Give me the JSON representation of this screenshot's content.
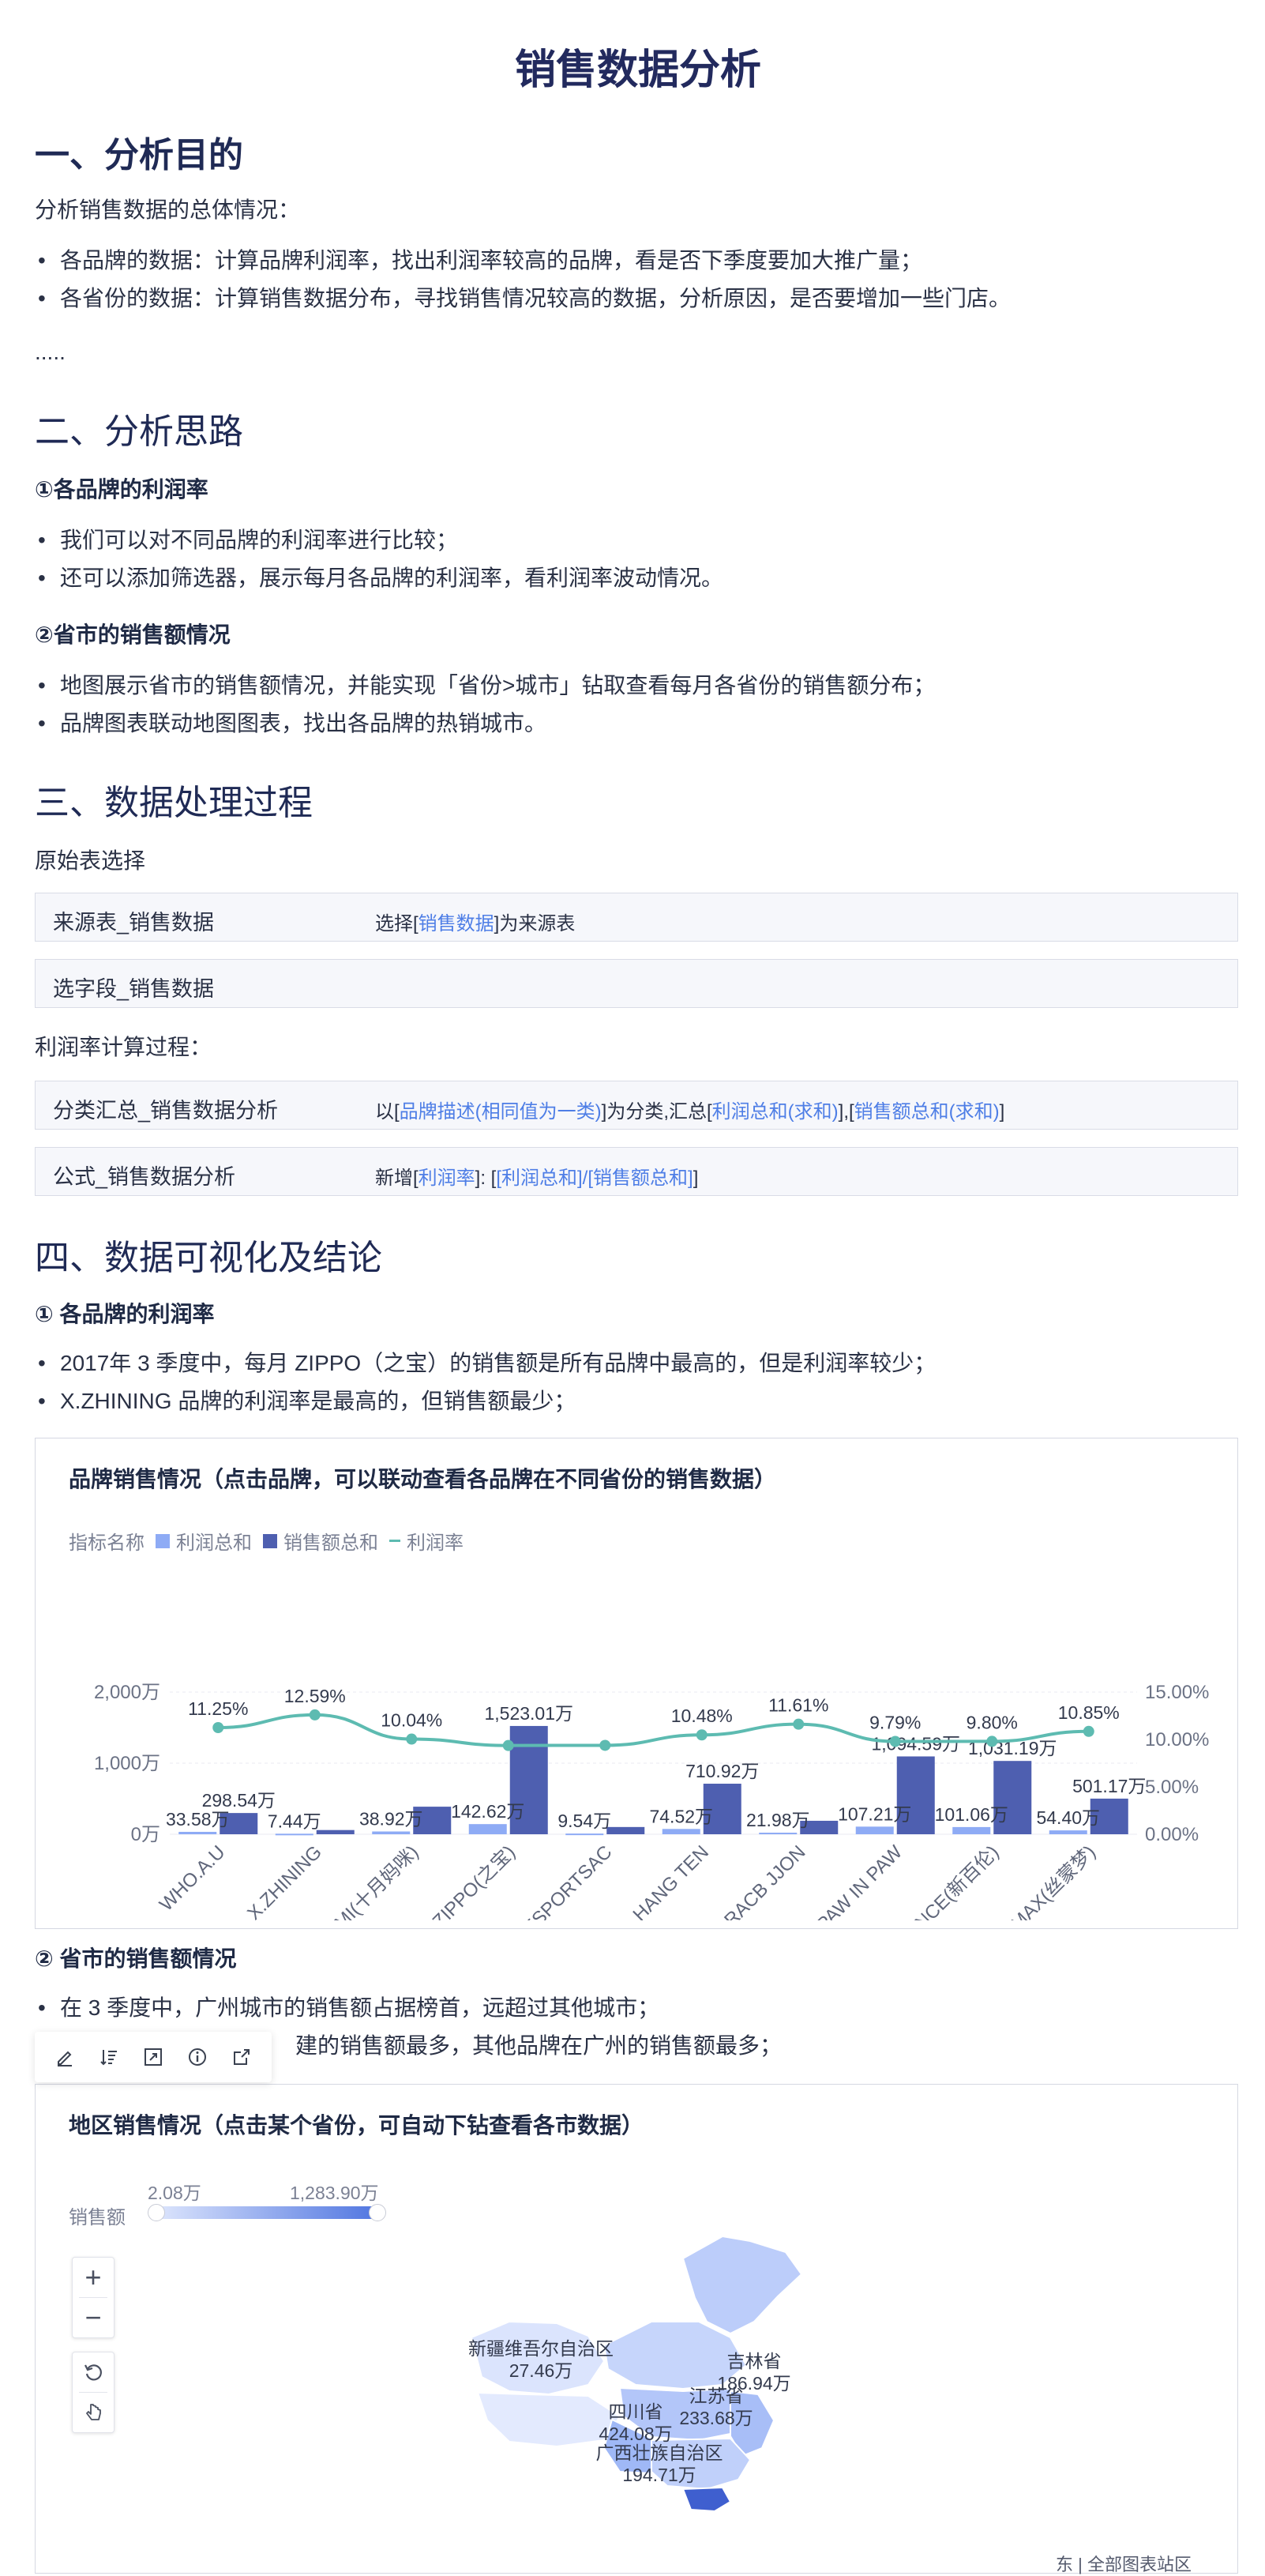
{
  "doc": {
    "title": "销售数据分析"
  },
  "s1": {
    "heading": "一、分析目的",
    "intro": "分析销售数据的总体情况：",
    "bullets": [
      "各品牌的数据：计算品牌利润率，找出利润率较高的品牌，看是否下季度要加大推广量；",
      "各省份的数据：计算销售数据分布，寻找销售情况较高的数据，分析原因，是否要增加一些门店。"
    ],
    "ellipsis": "....."
  },
  "s2": {
    "heading": "二、分析思路",
    "sub1": "①各品牌的利润率",
    "sub1_bullets": [
      "我们可以对不同品牌的利润率进行比较；",
      "还可以添加筛选器，展示每月各品牌的利润率，看利润率波动情况。"
    ],
    "sub2": "②省市的销售额情况",
    "sub2_bullets": [
      "地图展示省市的销售额情况，并能实现「省份>城市」钻取查看每月各省份的销售额分布；",
      "品牌图表联动地图图表，找出各品牌的热销城市。"
    ]
  },
  "s3": {
    "heading": "三、数据处理过程",
    "raw_label": "原始表选择",
    "step1": {
      "name": "来源表_销售数据",
      "pre": "选择[",
      "hl": "销售数据",
      "post": "]为来源表"
    },
    "step2": {
      "name": "选字段_销售数据"
    },
    "calc_label": "利润率计算过程：",
    "step3": {
      "name": "分类汇总_销售数据分析",
      "p1": "以[",
      "h1": "品牌描述(相同值为一类)",
      "p2": "]为分类,汇总[",
      "h2": "利润总和(求和)",
      "p3": "],[",
      "h3": "销售额总和(求和)",
      "p4": "]"
    },
    "step4": {
      "name": "公式_销售数据分析",
      "p1": "新增[",
      "h1": "利润率",
      "p2": "]: [",
      "h2": "[利润总和]/[销售额总和]",
      "p3": "]"
    }
  },
  "s4": {
    "heading": "四、数据可视化及结论",
    "sub1": "① 各品牌的利润率",
    "sub1_bullets": [
      " 2017年 3 季度中，每月 ZIPPO（之宝）的销售额是所有品牌中最高的，但是利润率较少；",
      "X.ZHINING 品牌的利润率是最高的，但销售额最少；"
    ],
    "sub2": "② 省市的销售额情况",
    "sub2_bullet1": "在 3 季度中，广州城市的销售额占据榜首，远超过其他城市；",
    "sub2_bullet2_visible": "建的销售额最多，其他品牌在广州的销售额最多；"
  },
  "chart_data": {
    "type": "bar",
    "title": "品牌销售情况（点击品牌，可以联动查看各品牌在不同省份的销售数据）",
    "legend_title": "指标名称",
    "legend_placement": "top-left",
    "categories": [
      "WHO.A.U",
      "X.ZHINING",
      "O.C.T.MAMI(十月妈咪)",
      "ZIPPO(之宝)",
      "LESPORTSAC",
      "HANG TEN",
      "RACB JJON",
      "PAW IN PAW",
      "NEW BALANCE(新百伦)",
      "SINOMAX(丝蒙梦)"
    ],
    "series": [
      {
        "name": "利润总和",
        "type": "bar",
        "axis": "left",
        "color": "#8eabf5",
        "values": [
          33.58,
          7.44,
          38.92,
          142.62,
          9.54,
          74.52,
          21.98,
          107.21,
          101.06,
          54.4
        ],
        "labels": [
          "33.58万",
          "7.44万",
          "38.92万",
          "142.62万",
          "9.54万",
          "74.52万",
          "21.98万",
          "107.21万",
          "101.06万",
          "54.40万"
        ]
      },
      {
        "name": "销售额总和",
        "type": "bar",
        "axis": "left",
        "color": "#4e5fb0",
        "values": [
          298.54,
          59.09,
          387.72,
          1523.01,
          101.72,
          710.92,
          189.39,
          1094.59,
          1031.19,
          501.17
        ],
        "labels": [
          "298.54万",
          "",
          "",
          "1,523.01万",
          "",
          "710.92万",
          "",
          "1,094.59万",
          "1,031.19万",
          "501.17万"
        ]
      },
      {
        "name": "利润率",
        "type": "line",
        "axis": "right",
        "color": "#5dbbb1",
        "values": [
          11.25,
          12.59,
          10.04,
          9.36,
          9.38,
          10.48,
          11.61,
          9.79,
          9.8,
          10.85
        ],
        "labels": [
          "11.25%",
          "12.59%",
          "10.04%",
          "",
          "",
          "10.48%",
          "11.61%",
          "9.79%",
          "9.80%",
          "10.85%"
        ]
      }
    ],
    "y_left": {
      "ticks": [
        "0万",
        "1,000万",
        "2,000万"
      ],
      "range": [
        0,
        2000
      ]
    },
    "y_right": {
      "ticks": [
        "0.00%",
        "5.00%",
        "10.00%",
        "15.00%"
      ],
      "range": [
        0,
        15
      ]
    },
    "grid": true
  },
  "map_card": {
    "title": "地区销售情况（点击某个省份，可自动下钻查看各市数据）",
    "scale_label": "销售额",
    "scale_min": "2.08万",
    "scale_max": "1,283.90万",
    "low_color": "#dfe7fd",
    "high_color": "#4e74e0",
    "regions": [
      {
        "name": "新疆维吾尔自治区",
        "value": "27.46万"
      },
      {
        "name": "吉林省",
        "value": "186.94万"
      },
      {
        "name": "四川省",
        "value": "424.08万"
      },
      {
        "name": "江苏省",
        "value": "233.68万"
      },
      {
        "name": "广西壮族自治区",
        "value": "194.71万"
      }
    ],
    "footer_partial": "东 | 全部图表站区"
  },
  "toolbar_icons": [
    "edit-icon",
    "sort-icon",
    "expand-icon",
    "info-icon",
    "export-icon"
  ],
  "zoom_icons": [
    "plus-icon",
    "minus-icon",
    "reset-icon",
    "pointer-icon"
  ]
}
